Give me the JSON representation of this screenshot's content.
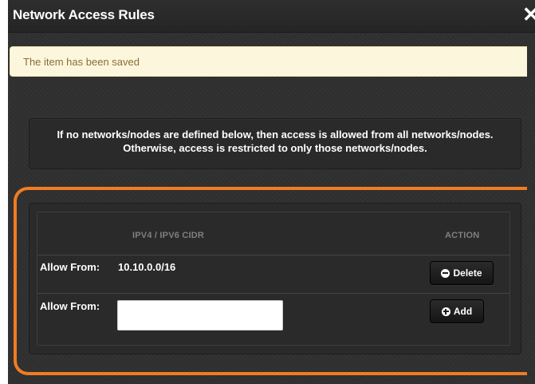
{
  "dialog": {
    "title": "Network Access Rules",
    "close_glyph": "✕"
  },
  "alert": {
    "message": "The item has been saved"
  },
  "info": {
    "text": "If no networks/nodes are defined below, then access is allowed from all networks/nodes. Otherwise, access is restricted to only those networks/nodes."
  },
  "table": {
    "headers": {
      "cidr": "IPV4 / IPV6 CIDR",
      "action": "ACTION"
    },
    "rows": [
      {
        "label": "Allow From:",
        "value": "10.10.0.0/16",
        "button": "Delete",
        "button_icon": "minus-circle-icon"
      }
    ],
    "new_row": {
      "label": "Allow From:",
      "input_value": "",
      "button": "Add",
      "button_icon": "plus-circle-icon"
    }
  },
  "colors": {
    "highlight": "#f07c22",
    "alert_bg": "#fcf7dc",
    "alert_text": "#8a6d3b"
  }
}
